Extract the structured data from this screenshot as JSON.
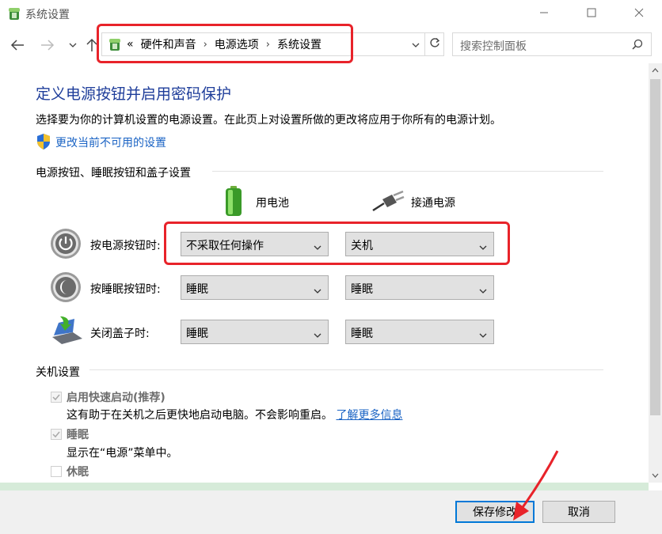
{
  "window": {
    "title": "系统设置"
  },
  "address": {
    "prefix": "«",
    "breadcrumb": [
      "硬件和声音",
      "电源选项",
      "系统设置"
    ],
    "search_placeholder": "搜索控制面板"
  },
  "page": {
    "title": "定义电源按钮并启用密码保护",
    "description": "选择要为你的计算机设置的电源设置。在此页上对设置所做的更改将应用于你所有的电源计划。",
    "change_link": "更改当前不可用的设置"
  },
  "power_section": {
    "heading": "电源按钮、睡眠按钮和盖子设置",
    "col_battery": "用电池",
    "col_plugged": "接通电源",
    "rows": [
      {
        "label": "按电源按钮时:",
        "battery": "不采取任何操作",
        "plugged": "关机"
      },
      {
        "label": "按睡眠按钮时:",
        "battery": "睡眠",
        "plugged": "睡眠"
      },
      {
        "label": "关闭盖子时:",
        "battery": "睡眠",
        "plugged": "睡眠"
      }
    ]
  },
  "shutdown_section": {
    "heading": "关机设置",
    "options": [
      {
        "label": "启用快速启动(推荐)",
        "checked": true,
        "desc": "这有助于在关机之后更快地启动电脑。不会影响重启。",
        "link": "了解更多信息"
      },
      {
        "label": "睡眠",
        "checked": true,
        "desc": "显示在“电源”菜单中。"
      },
      {
        "label": "休眠",
        "checked": false
      }
    ]
  },
  "footer": {
    "save": "保存修改",
    "cancel": "取消"
  },
  "colors": {
    "accent": "#0078d7",
    "title": "#1e3d9a",
    "link": "#1a63c4",
    "annotation": "#e8232a"
  }
}
